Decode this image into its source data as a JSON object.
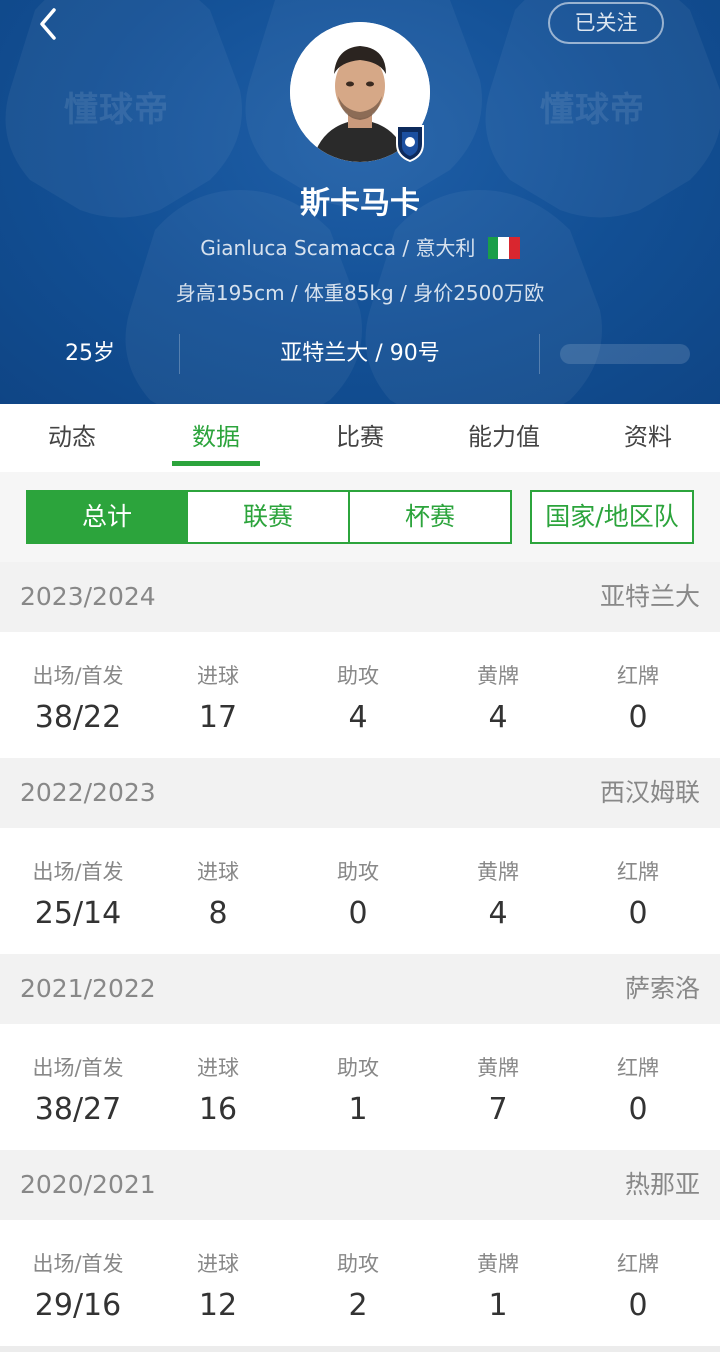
{
  "header": {
    "follow_label": "已关注",
    "watermark": "懂球帝",
    "player_name": "斯卡马卡",
    "english_name": "Gianluca Scamacca",
    "nationality": "意大利",
    "body_info": "身高195cm / 体重85kg / 身价2500万欧",
    "age": "25岁",
    "team_number": "亚特兰大 / 90号",
    "colors": {
      "bg": "#124f94",
      "accent": "#2ca43c"
    },
    "icons": [
      "back-arrow-icon",
      "avatar",
      "club-badge-icon",
      "italy-flag-icon"
    ]
  },
  "tabs": [
    {
      "label": "动态"
    },
    {
      "label": "数据"
    },
    {
      "label": "比赛"
    },
    {
      "label": "能力值"
    },
    {
      "label": "资料"
    }
  ],
  "filters": [
    {
      "label": "总计"
    },
    {
      "label": "联赛"
    },
    {
      "label": "杯赛"
    },
    {
      "label": "国家/地区队"
    }
  ],
  "column_labels": [
    "出场/首发",
    "进球",
    "助攻",
    "黄牌",
    "红牌"
  ],
  "seasons": [
    {
      "year": "2023/2024",
      "club": "亚特兰大",
      "values": [
        "38/22",
        "17",
        "4",
        "4",
        "0"
      ]
    },
    {
      "year": "2022/2023",
      "club": "西汉姆联",
      "values": [
        "25/14",
        "8",
        "0",
        "4",
        "0"
      ]
    },
    {
      "year": "2021/2022",
      "club": "萨索洛",
      "values": [
        "38/27",
        "16",
        "1",
        "7",
        "0"
      ]
    },
    {
      "year": "2020/2021",
      "club": "热那亚",
      "values": [
        "29/16",
        "12",
        "2",
        "1",
        "0"
      ]
    }
  ]
}
